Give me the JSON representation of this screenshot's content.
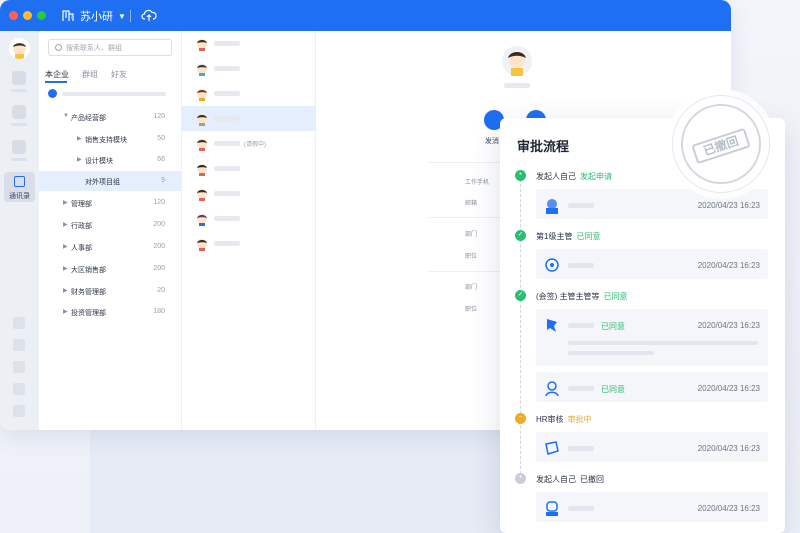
{
  "app": {
    "org_name": "苏小研"
  },
  "sidebar": {
    "active_label": "通讯录"
  },
  "tree": {
    "search_placeholder": "搜索联系人、群组",
    "tabs": [
      "本企业",
      "群组",
      "好友"
    ],
    "active_tab": 0,
    "rows": [
      {
        "name": "产品经营部",
        "count": "120",
        "expanded": true
      },
      {
        "name": "销售支持模块",
        "count": "50"
      },
      {
        "name": "设计模块",
        "count": "66"
      },
      {
        "name": "对外项目组",
        "count": "9",
        "selected": true
      },
      {
        "name": "管理部",
        "count": "120"
      },
      {
        "name": "行政部",
        "count": "200"
      },
      {
        "name": "人事部",
        "count": "200"
      },
      {
        "name": "大区销售部",
        "count": "200"
      },
      {
        "name": "财务管理部",
        "count": "20"
      },
      {
        "name": "投资管理部",
        "count": "180"
      }
    ]
  },
  "members": {
    "invite_tag": "(请假中)"
  },
  "profile": {
    "action_label": "发消",
    "fields": [
      "工作手机",
      "邮箱",
      "部门",
      "职位",
      "部门",
      "职位"
    ]
  },
  "approval": {
    "title": "审批流程",
    "steps": [
      {
        "title": "发起人自己",
        "status": "发起申请",
        "status_color": "green"
      },
      {
        "title": "第1级主管",
        "status": "已同意",
        "status_color": "green"
      },
      {
        "title": "(会签) 主管主管等",
        "status": "已同意",
        "status_color": "green"
      },
      {
        "title": "HR审核",
        "status": "审批中",
        "status_color": "orange"
      },
      {
        "title": "发起人自己",
        "status": "已撤回",
        "status_color": "grey"
      }
    ],
    "entries": [
      {
        "status": "",
        "date": "2020/04/23 16:23"
      },
      {
        "status": "",
        "date": "2020/04/23 16:23"
      },
      {
        "status": "已同意",
        "date": "2020/04/23 16:23"
      },
      {
        "status": "已同意",
        "date": "2020/04/23 16:23"
      },
      {
        "status": "",
        "date": "2020/04/23 16:23"
      },
      {
        "status": "",
        "date": "2020/04/23 16:23"
      }
    ],
    "stamp": "已撤回"
  },
  "colors": {
    "brand": "#1e6ff1",
    "approved": "#2bbd72",
    "pending": "#f5a623"
  }
}
